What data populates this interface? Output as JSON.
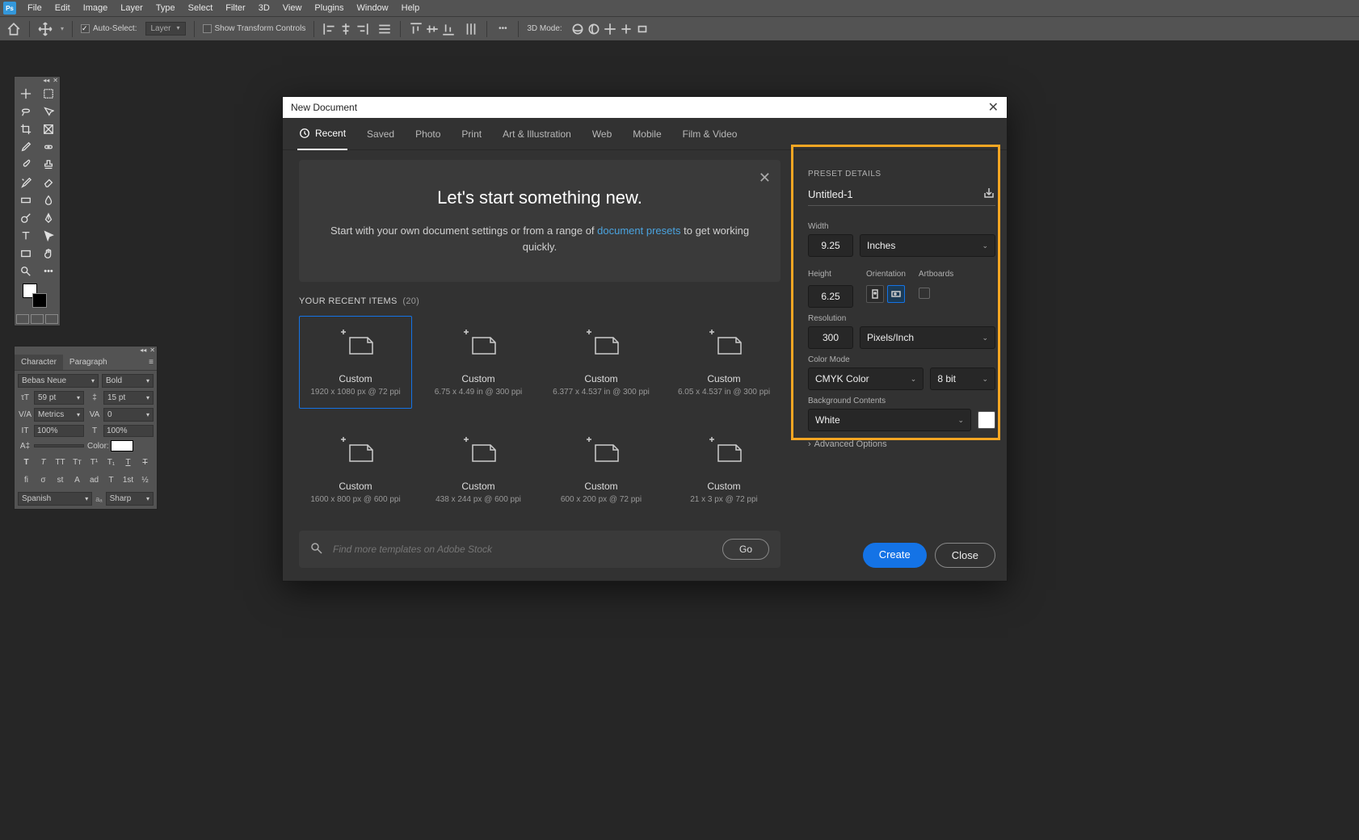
{
  "menubar": {
    "app": "Ps",
    "items": [
      "File",
      "Edit",
      "Image",
      "Layer",
      "Type",
      "Select",
      "Filter",
      "3D",
      "View",
      "Plugins",
      "Window",
      "Help"
    ]
  },
  "optionsbar": {
    "auto_select": "Auto-Select:",
    "auto_select_target": "Layer",
    "show_transform": "Show Transform Controls",
    "mode_3d": "3D Mode:"
  },
  "char_panel": {
    "tabs": [
      "Character",
      "Paragraph"
    ],
    "font": "Bebas Neue",
    "style": "Bold",
    "size": "59 pt",
    "leading": "15 pt",
    "va": "Metrics",
    "va2": "0",
    "scale_h": "100%",
    "scale_v": "100%",
    "color_label": "Color:",
    "lang": "Spanish",
    "aa": "Sharp"
  },
  "dialog": {
    "title": "New Document",
    "tabs": [
      "Recent",
      "Saved",
      "Photo",
      "Print",
      "Art & Illustration",
      "Web",
      "Mobile",
      "Film & Video"
    ],
    "hero": {
      "title": "Let's start something new.",
      "lead": "Start with your own document settings or from a range of ",
      "link": "document presets",
      "trail": " to get working quickly."
    },
    "recent_label": "YOUR RECENT ITEMS",
    "recent_count": "(20)",
    "presets": [
      {
        "title": "Custom",
        "sub": "1920 x 1080 px @ 72 ppi"
      },
      {
        "title": "Custom",
        "sub": "6.75 x 4.49 in @ 300 ppi"
      },
      {
        "title": "Custom",
        "sub": "6.377 x 4.537 in @ 300 ppi"
      },
      {
        "title": "Custom",
        "sub": "6.05 x 4.537 in @ 300 ppi"
      },
      {
        "title": "Custom",
        "sub": "1600 x 800 px @ 600 ppi"
      },
      {
        "title": "Custom",
        "sub": "438 x 244 px @ 600 ppi"
      },
      {
        "title": "Custom",
        "sub": "600 x 200 px @ 72 ppi"
      },
      {
        "title": "Custom",
        "sub": "21 x 3 px @ 72 ppi"
      }
    ],
    "search_placeholder": "Find more templates on Adobe Stock",
    "go": "Go",
    "details": {
      "header": "PRESET DETAILS",
      "name": "Untitled-1",
      "width_label": "Width",
      "width": "9.25",
      "unit": "Inches",
      "height_label": "Height",
      "height": "6.25",
      "orientation_label": "Orientation",
      "artboards_label": "Artboards",
      "resolution_label": "Resolution",
      "resolution": "300",
      "res_unit": "Pixels/Inch",
      "color_mode_label": "Color Mode",
      "color_mode": "CMYK Color",
      "bit_depth": "8 bit",
      "bg_label": "Background Contents",
      "bg": "White",
      "advanced": "Advanced Options",
      "create": "Create",
      "close": "Close"
    }
  }
}
